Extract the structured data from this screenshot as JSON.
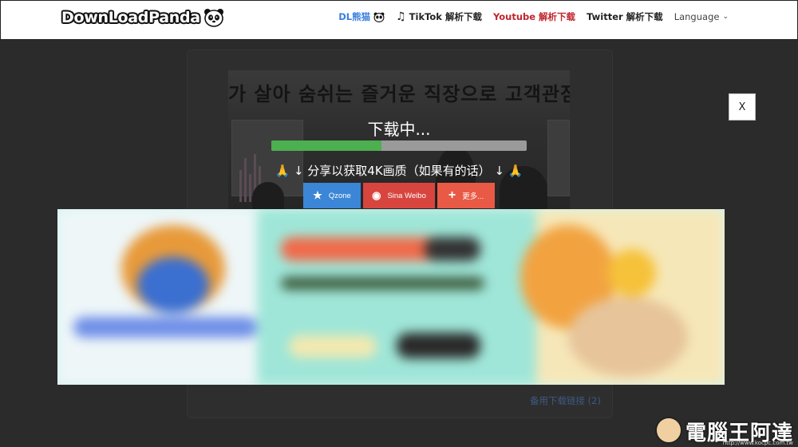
{
  "header": {
    "logo_text": "DownLoadPanda",
    "nav": [
      {
        "label": "DL熊猫"
      },
      {
        "label": "TikTok 解析下载"
      },
      {
        "label": "Youtube 解析下载"
      },
      {
        "label": "Twitter 解析下载"
      },
      {
        "label": "Language"
      }
    ]
  },
  "background": {
    "image_text": "가 살아 숨쉬는 즐거운 직장으로 고객관점서",
    "alt_link": "备用下载链接 (2)"
  },
  "overlay": {
    "title": "下载中...",
    "progress": 0.43,
    "share_prompt": "🙏 ↓ 分享以获取4K画质（如果有的话） ↓ 🙏",
    "share_buttons": [
      {
        "label": "Qzone",
        "color": "#3b86d6"
      },
      {
        "label": "Sina Weibo",
        "color": "#d8453f"
      },
      {
        "label": "更多...",
        "color": "#e85a45"
      }
    ],
    "close_label": "X"
  },
  "watermark": {
    "text": "電腦王阿達",
    "url": "http://www.kocpc.com.tw"
  }
}
